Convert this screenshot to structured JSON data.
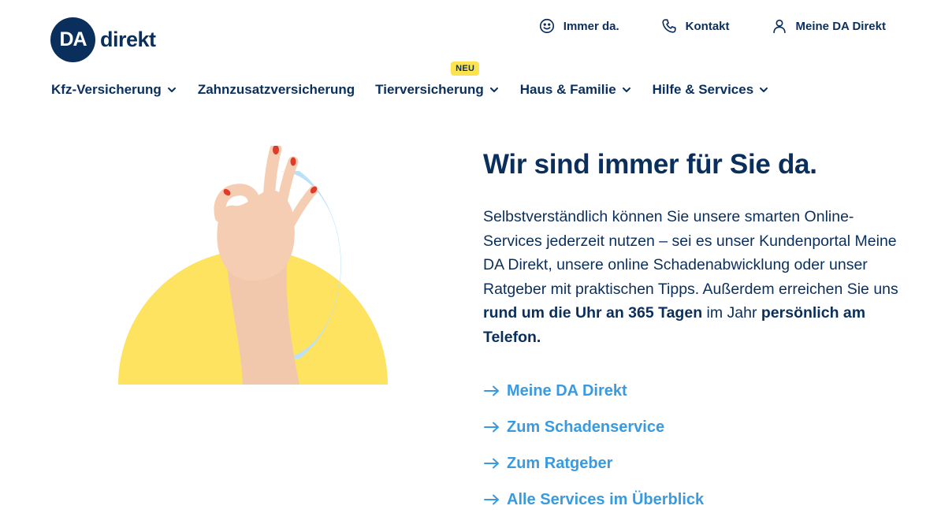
{
  "logo": {
    "mark": "DA",
    "word": "direkt"
  },
  "utility_nav": [
    {
      "label": "Immer da.",
      "icon": "smiley-icon"
    },
    {
      "label": "Kontakt",
      "icon": "phone-icon"
    },
    {
      "label": "Meine DA Direkt",
      "icon": "user-icon"
    }
  ],
  "main_nav": [
    {
      "label": "Kfz-Versicherung",
      "has_dropdown": true
    },
    {
      "label": "Zahnzusatzversicherung",
      "has_dropdown": false
    },
    {
      "label": "Tierversicherung",
      "has_dropdown": true,
      "badge": "NEU"
    },
    {
      "label": "Haus & Familie",
      "has_dropdown": true
    },
    {
      "label": "Hilfe & Services",
      "has_dropdown": true
    }
  ],
  "hero": {
    "headline": "Wir sind immer für Sie da.",
    "body_part1": "Selbstverständlich können Sie unsere smarten Online-Services jederzeit nutzen – sei es unser Kundenportal Meine DA Direkt, unsere online Schadenabwicklung oder unser Ratgeber mit praktischen Tipps. Außerdem erreichen Sie uns ",
    "body_bold1": "rund um die Uhr an 365 Tagen",
    "body_part2": " im Jahr ",
    "body_bold2": "persönlich am Telefon.",
    "links": [
      "Meine DA Direkt",
      "Zum Schadenservice",
      "Zum Ratgeber",
      "Alle Services im Überblick"
    ]
  },
  "colors": {
    "brand_navy": "#0a2f5c",
    "link_blue": "#3a9ae0",
    "badge_yellow": "#fde34f",
    "art_yellow": "#fde35f",
    "art_lightblue": "#bde0f8"
  }
}
